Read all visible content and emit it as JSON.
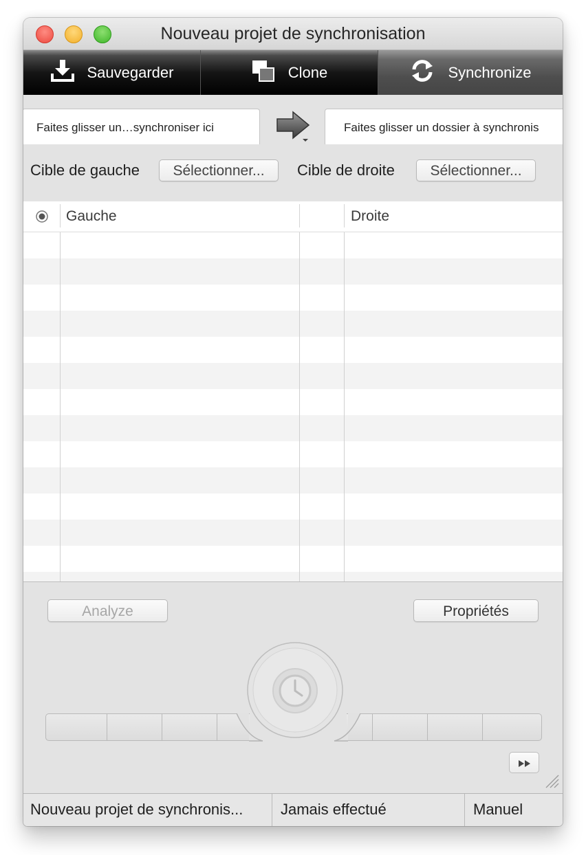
{
  "window": {
    "title": "Nouveau projet de synchronisation"
  },
  "toolbar": {
    "tabs": [
      {
        "label": "Sauvegarder",
        "icon": "download-icon"
      },
      {
        "label": "Clone",
        "icon": "clone-icon"
      },
      {
        "label": "Synchronize",
        "icon": "sync-icon",
        "selected": true
      }
    ]
  },
  "drop": {
    "left": "Faites glisser un…synchroniser ici",
    "right": "Faites glisser un dossier à synchronis",
    "arrow_icon": "right-arrow-icon"
  },
  "targets": {
    "left_label": "Cible de gauche",
    "left_button": "Sélectionner...",
    "right_label": "Cible de droite",
    "right_button": "Sélectionner..."
  },
  "table": {
    "status_icon": "status-dot-icon",
    "col_left": "Gauche",
    "col_right": "Droite"
  },
  "actions": {
    "analyze": "Analyze",
    "properties": "Propriétés",
    "schedule_icon": "clock-icon",
    "fast_forward_icon": "fast-forward-icon"
  },
  "status": {
    "project": "Nouveau projet de synchronis...",
    "last_run": "Jamais effectué",
    "mode": "Manuel"
  },
  "colors": {
    "toolbar_dark": "#000000",
    "toolbar_selected": "#4e4e4e",
    "window_bg": "#e3e3e3",
    "row_alt": "#f3f3f3"
  }
}
